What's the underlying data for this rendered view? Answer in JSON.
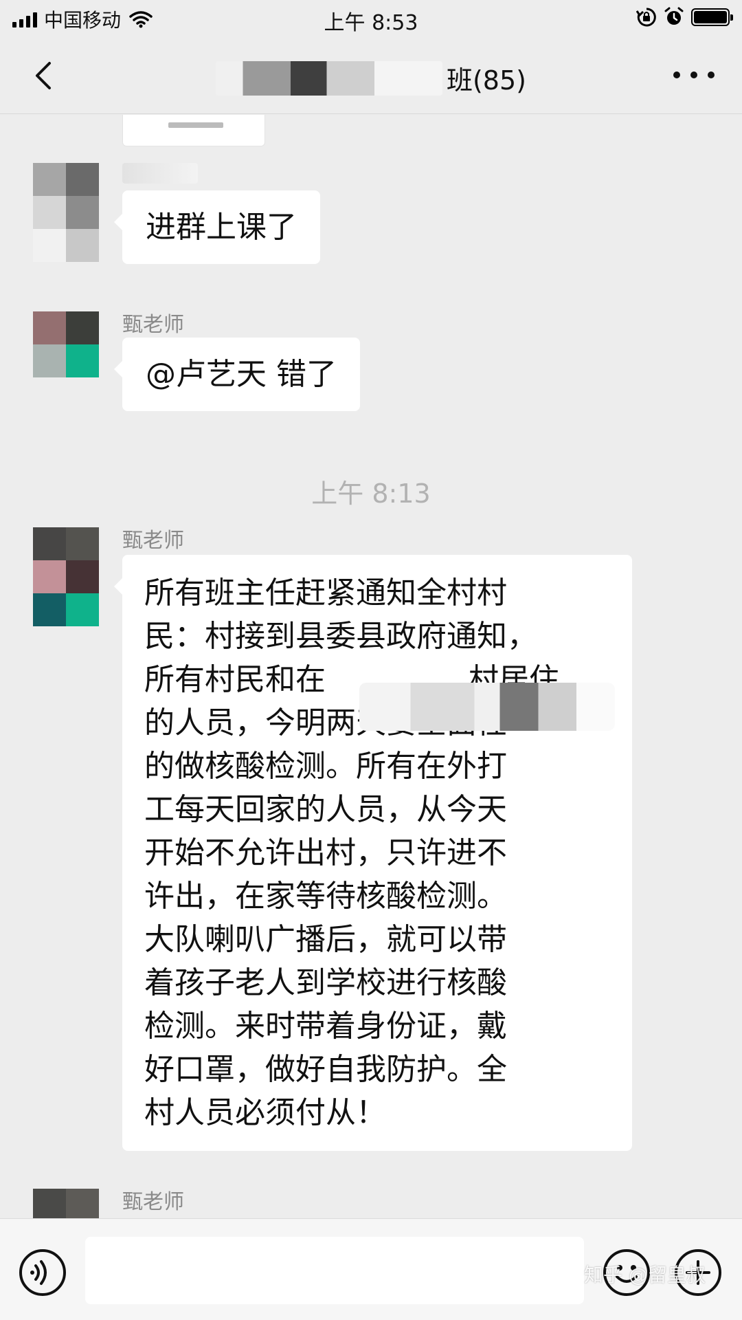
{
  "status_bar": {
    "carrier": "中国移动",
    "time": "上午 8:53",
    "icons": [
      "signal-icon",
      "wifi-icon",
      "rotation-lock-icon",
      "alarm-icon",
      "battery-icon"
    ]
  },
  "nav": {
    "title": "班(85)",
    "back_icon": "chevron-left-icon",
    "more_icon": "more-dots-icon"
  },
  "messages": [
    {
      "sender": "",
      "text": "进群上课了"
    },
    {
      "sender": "甄老师",
      "text": "@卢艺天 错了"
    },
    {
      "sender": "甄老师",
      "lines": [
        "所有班主任赶紧通知全村村",
        "民：村接到县委县政府通知，",
        "所有村民和在",
        "的人员，今明两天要全面性",
        "的做核酸检测。所有在外打",
        "工每天回家的人员，从今天",
        "开始不允许出村，只许进不",
        "许出，在家等待核酸检测。",
        "大队喇叭广播后，就可以带",
        "着孩子老人到学校进行核酸",
        "检测。来时带着身份证，戴",
        "好口罩，做好自我防护。全",
        "村人员必须付从！"
      ],
      "line3_tail": "村居住"
    },
    {
      "sender": "甄老师"
    }
  ],
  "time_separator": "上午 8:13",
  "input_bar": {
    "voice_icon": "voice-icon",
    "emoji_icon": "emoji-icon",
    "plus_icon": "plus-icon"
  },
  "watermark": "知乎 @留皇叔",
  "colors": {
    "background": "#ededed",
    "bubble": "#ffffff",
    "timestamp": "#b2b2b2",
    "sender_name": "#8a8a8a"
  }
}
